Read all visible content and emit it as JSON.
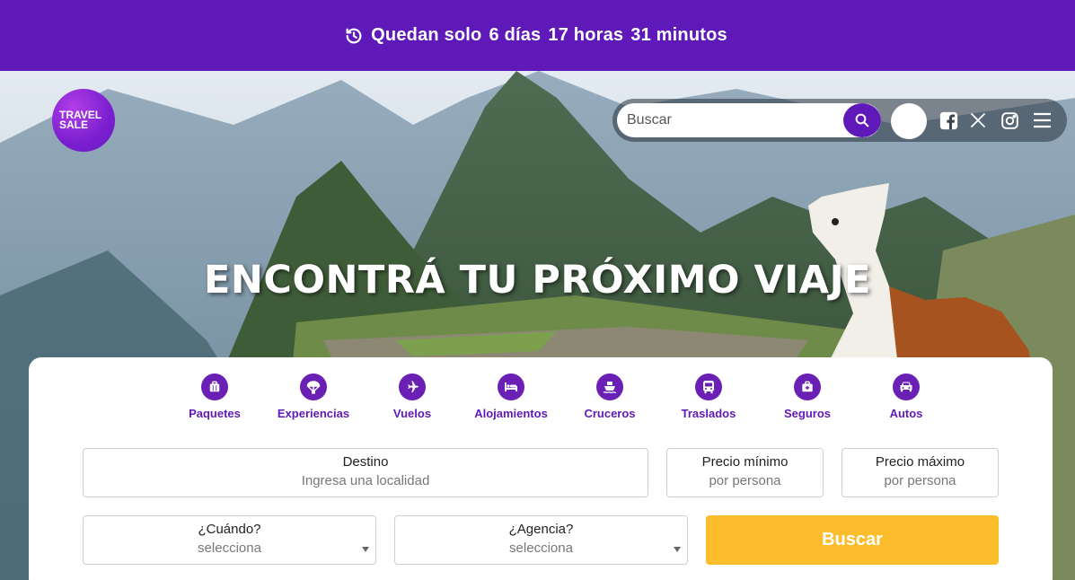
{
  "banner": {
    "prefix": "Quedan solo",
    "days": "6 días",
    "hours": "17 horas",
    "minutes": "31 minutos",
    "clock_icon": "clock-history-icon"
  },
  "logo": {
    "line1": "TRAVEL",
    "line2": "SALE"
  },
  "header": {
    "search_placeholder": "Buscar",
    "social_icons": [
      "facebook-icon",
      "x-icon",
      "instagram-icon"
    ],
    "menu_icon": "hamburger-menu-icon"
  },
  "hero": {
    "headline": "ENCONTRÁ TU PRÓXIMO VIAJE"
  },
  "categories": [
    {
      "label": "Paquetes",
      "icon": "suitcase-icon"
    },
    {
      "label": "Experiencias",
      "icon": "parachute-icon"
    },
    {
      "label": "Vuelos",
      "icon": "plane-icon"
    },
    {
      "label": "Alojamientos",
      "icon": "bed-icon"
    },
    {
      "label": "Cruceros",
      "icon": "ship-icon"
    },
    {
      "label": "Traslados",
      "icon": "bus-icon"
    },
    {
      "label": "Seguros",
      "icon": "medical-kit-icon"
    },
    {
      "label": "Autos",
      "icon": "car-icon"
    }
  ],
  "form": {
    "destino": {
      "label": "Destino",
      "placeholder": "Ingresa una localidad"
    },
    "precio_min": {
      "label": "Precio mínimo",
      "placeholder": "por persona"
    },
    "precio_max": {
      "label": "Precio máximo",
      "placeholder": "por persona"
    },
    "cuando": {
      "label": "¿Cuándo?",
      "value": "selecciona"
    },
    "agencia": {
      "label": "¿Agencia?",
      "value": "selecciona"
    },
    "submit": "Buscar"
  },
  "colors": {
    "brand_purple": "#5f19b8",
    "accent_yellow": "#fbbd2b"
  }
}
